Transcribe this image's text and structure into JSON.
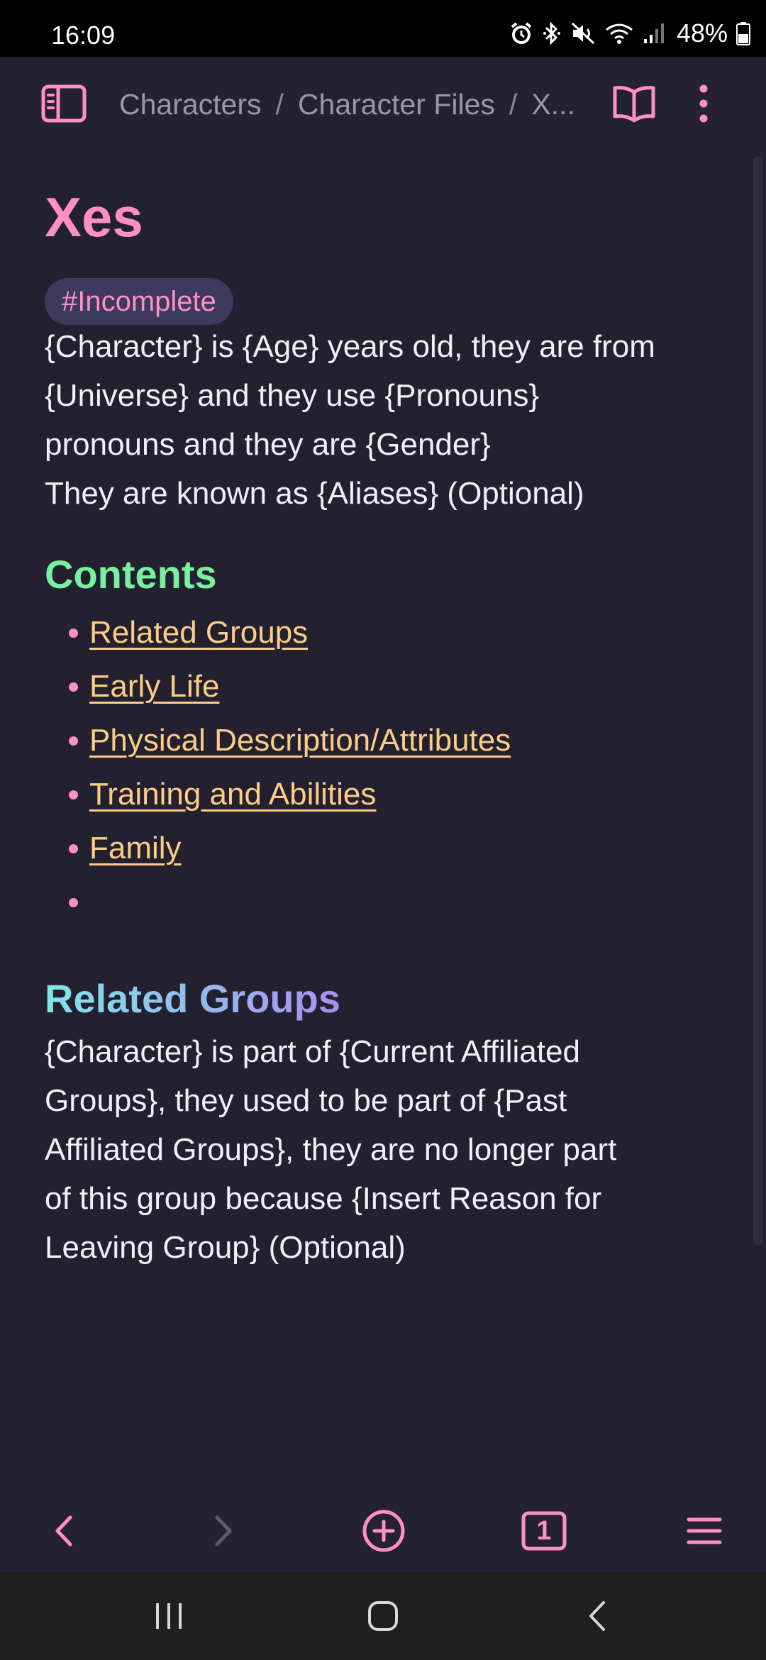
{
  "status_bar": {
    "time": "16:09",
    "battery": "48%",
    "icons": [
      "alarm-icon",
      "bluetooth-icon",
      "mute-icon",
      "wifi-icon",
      "signal-icon",
      "battery-icon"
    ]
  },
  "top_bar": {
    "breadcrumb": [
      "Characters",
      "Character Files",
      "X..."
    ],
    "separator": "/",
    "icons": [
      "sidebar-toggle-icon",
      "reading-mode-icon",
      "more-options-icon"
    ]
  },
  "note": {
    "title": "Xes",
    "tag": "#Incomplete",
    "intro_lines": [
      "{Character} is {Age} years old, they are from",
      "{Universe} and they use {Pronouns}",
      "pronouns and they are {Gender}",
      "They are known as {Aliases} (Optional)"
    ],
    "contents_heading": "Contents",
    "toc": [
      "Related Groups",
      "Early Life",
      "Physical Description/Attributes",
      "Training and Abilities",
      "Family",
      ""
    ],
    "related_heading": "Related Groups",
    "related_lines": [
      "{Character} is part of {Current Affiliated",
      "Groups}, they used to be part of {Past",
      "Affiliated Groups}, they are no longer part",
      "of this group because {Insert Reason for",
      "Leaving Group} (Optional)"
    ]
  },
  "bottom_bar": {
    "tab_count": "1",
    "icons": [
      "back-arrow-icon",
      "forward-arrow-icon",
      "new-note-icon",
      "tabs-icon",
      "menu-icon"
    ]
  },
  "nav_bar": {
    "icons": [
      "recent-apps-icon",
      "home-icon",
      "system-back-icon"
    ]
  },
  "colors": {
    "background": "#232130",
    "accent_pink": "#ff8fc5",
    "heading_green": "#79f0a0",
    "link_orange": "#fccd86",
    "heading_gradient_start": "#7fe8e6",
    "heading_gradient_end": "#a88ff2",
    "tag_background": "#3d3a5e"
  }
}
